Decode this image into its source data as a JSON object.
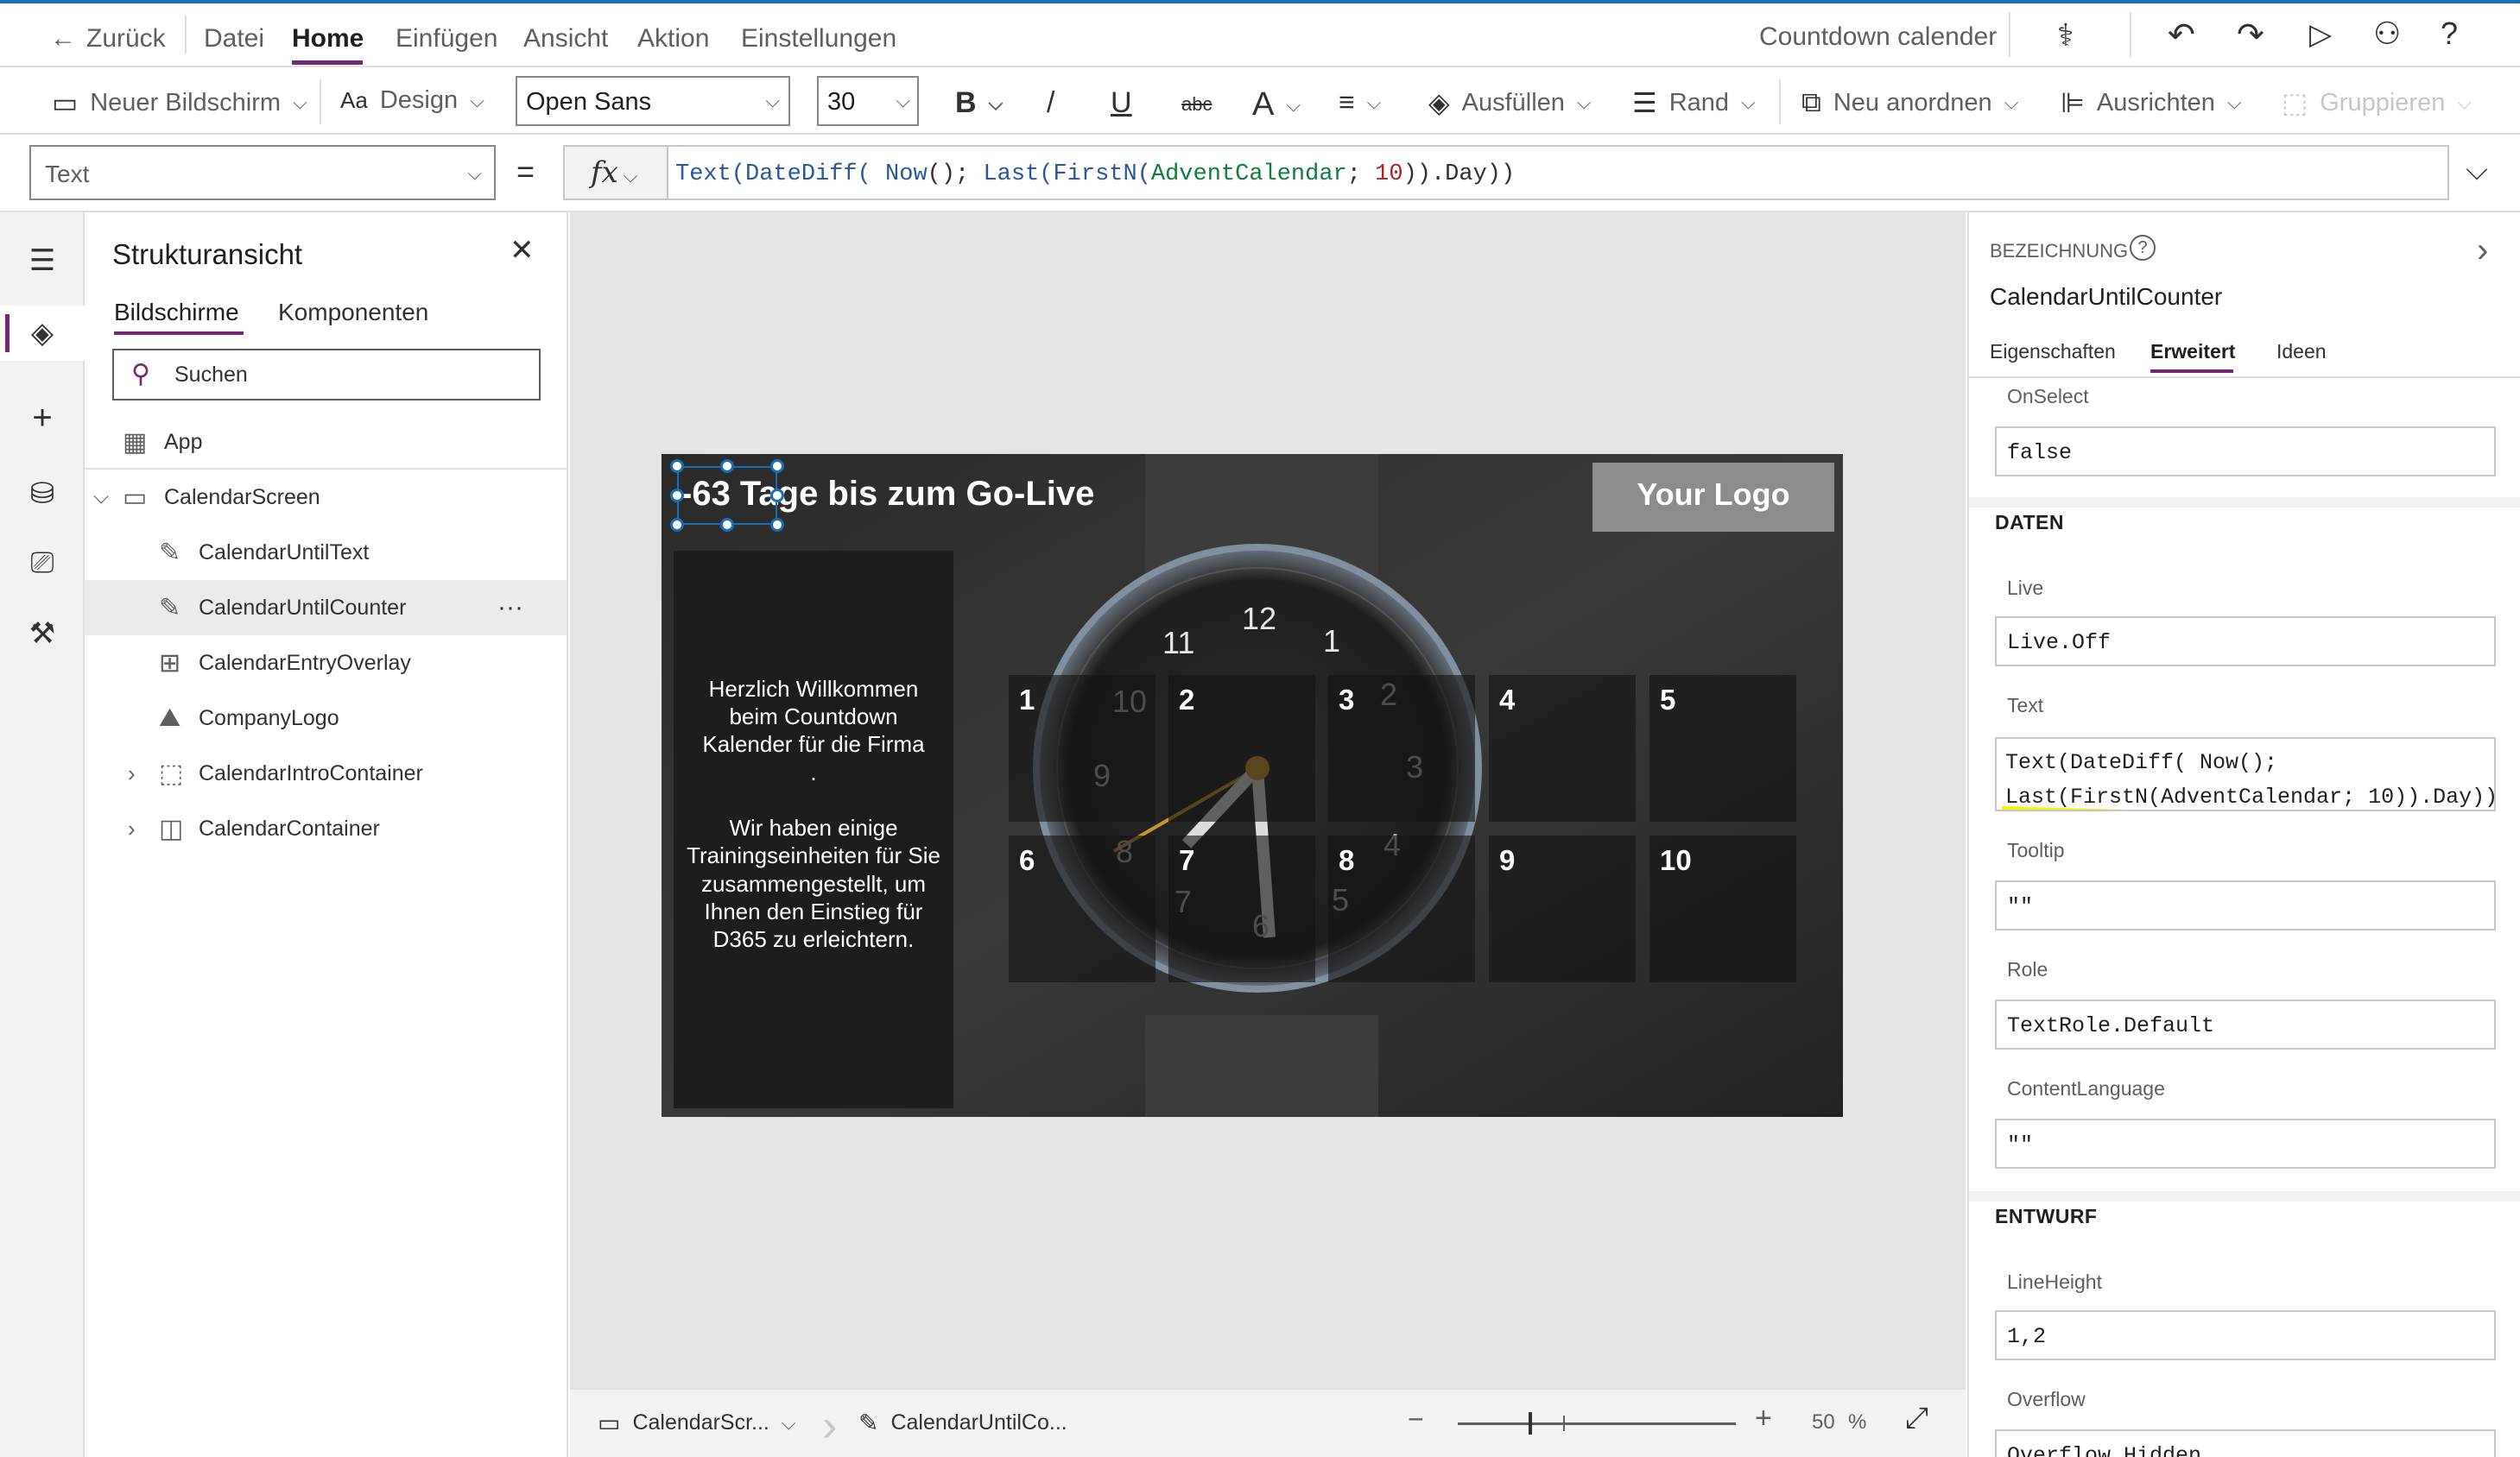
{
  "menubar": {
    "back": "Zurück",
    "items": [
      "Datei",
      "Home",
      "Einfügen",
      "Ansicht",
      "Aktion",
      "Einstellungen"
    ],
    "app_title": "Countdown calender"
  },
  "toolbar": {
    "new_screen": "Neuer Bildschirm",
    "design": "Design",
    "font": "Open Sans",
    "font_size": "30",
    "bold": "B",
    "italic": "/",
    "underline": "U",
    "strike": "abc",
    "fontcolor": "A",
    "fill": "Ausfüllen",
    "border": "Rand",
    "reorder": "Neu anordnen",
    "align": "Ausrichten",
    "group": "Gruppieren"
  },
  "formulabar": {
    "property": "Text",
    "equals": "=",
    "fx": "fx",
    "formula": {
      "p1": "Text(",
      "p2": "DateDiff(",
      "p3": " ",
      "p4": "Now",
      "p5": "(); ",
      "p6": "Last(",
      "p7": "FirstN(",
      "p8": "AdventCalendar",
      "p9": "; ",
      "p10": "10",
      "p11": ")).Day))"
    }
  },
  "tree": {
    "title": "Strukturansicht",
    "tabs": [
      "Bildschirme",
      "Komponenten"
    ],
    "search_placeholder": "Suchen",
    "items": [
      "App",
      "CalendarScreen",
      "CalendarUntilText",
      "CalendarUntilCounter",
      "CalendarEntryOverlay",
      "CompanyLogo",
      "CalendarIntroContainer",
      "CalendarContainer"
    ],
    "more": "···"
  },
  "canvas": {
    "headline": "-63 Tage bis zum Go-Live",
    "logo": "Your Logo",
    "intro": "Herzlich Willkommen beim Countdown Kalender für die Firma\n.\n\nWir haben einige Trainingseinheiten für Sie zusammengestellt, um Ihnen den Einstieg für D365 zu erleichtern.",
    "tiles": [
      "1",
      "2",
      "3",
      "4",
      "5",
      "6",
      "7",
      "8",
      "9",
      "10"
    ],
    "clock_numbers": [
      "12",
      "1",
      "2",
      "3",
      "4",
      "5",
      "6",
      "7",
      "8",
      "9",
      "10",
      "11"
    ]
  },
  "bottombar": {
    "screen": "CalendarScr...",
    "control": "CalendarUntilCo...",
    "zoom_minus": "−",
    "zoom_plus": "+",
    "zoom": "50",
    "percent": "%"
  },
  "rightpanel": {
    "label_heading": "BEZEICHNUNG",
    "control_name": "CalendarUntilCounter",
    "tabs": [
      "Eigenschaften",
      "Erweitert",
      "Ideen"
    ],
    "onselect_label": "OnSelect",
    "onselect_value": "false",
    "section_data": "DATEN",
    "live_label": "Live",
    "live_value": "Live.Off",
    "text_label": "Text",
    "text_value_line1": "Text(DateDiff( Now();",
    "text_value_line2": "Last(FirstN(AdventCalendar; 10)).Day))",
    "tooltip_label": "Tooltip",
    "tooltip_value": "\"\"",
    "role_label": "Role",
    "role_value": "TextRole.Default",
    "contentlang_label": "ContentLanguage",
    "contentlang_value": "\"\"",
    "section_design": "ENTWURF",
    "lineheight_label": "LineHeight",
    "lineheight_value": "1,2",
    "overflow_label": "Overflow",
    "overflow_value": "Overflow.Hidden"
  },
  "colors": {
    "accent": "#742774",
    "selection": "#1a6fb4",
    "highlight": "#f8f400"
  }
}
